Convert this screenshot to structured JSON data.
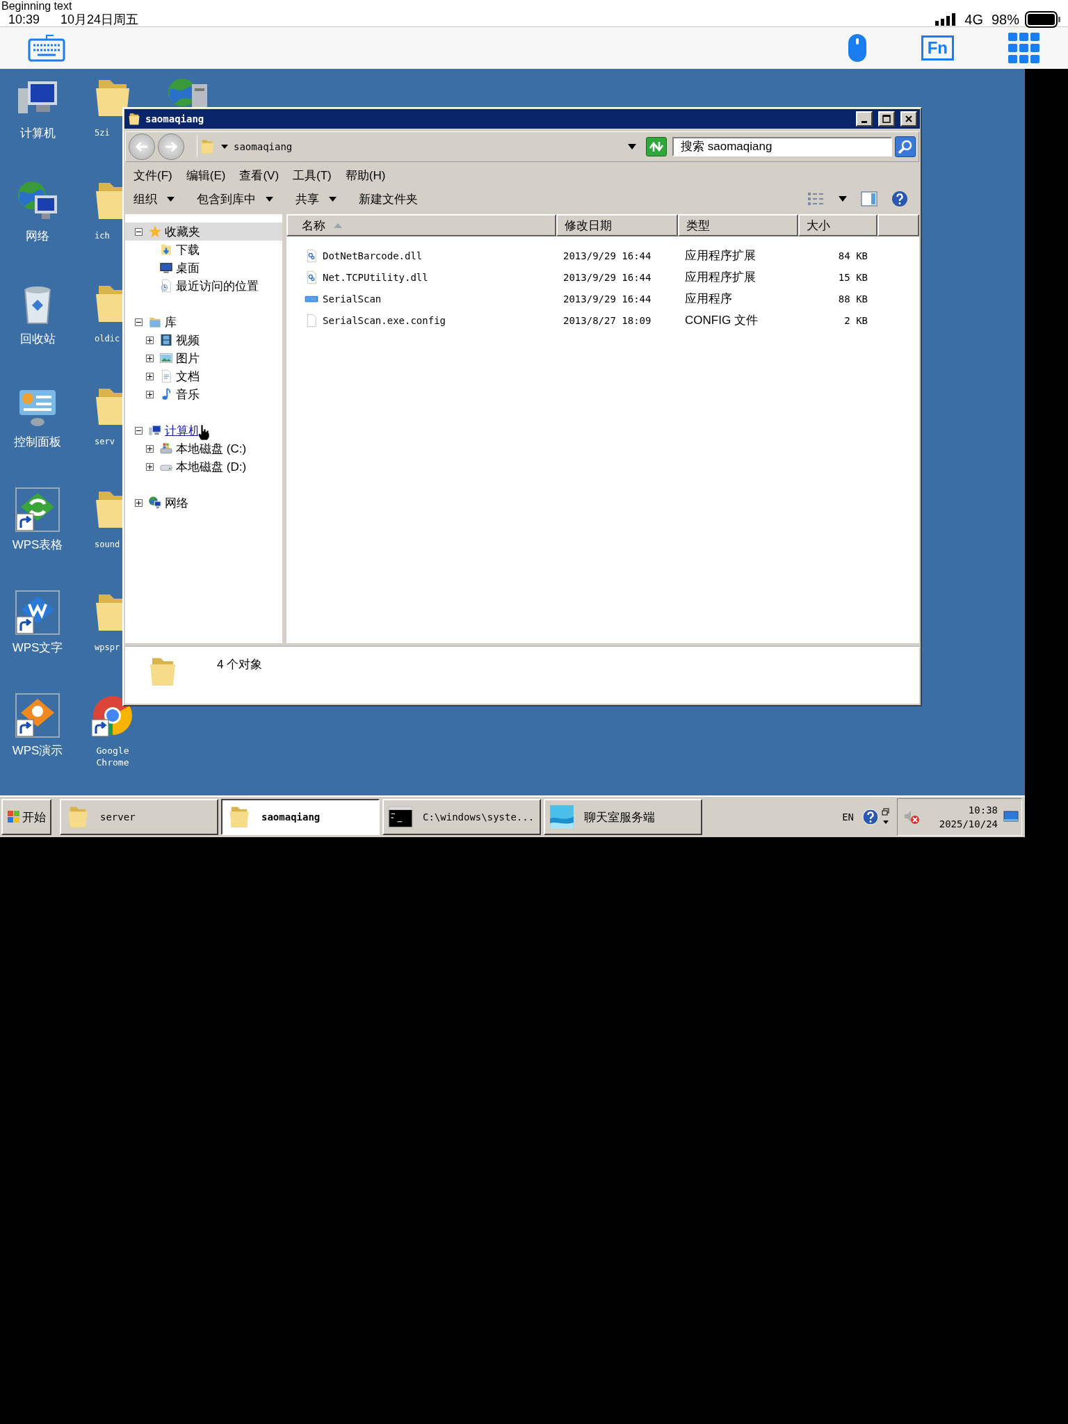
{
  "status_bar": {
    "overlay_text": "Beginning text",
    "time": "10:39",
    "date": "10月24日周五",
    "network": "4G",
    "battery": "98%"
  },
  "remote_toolbar": {
    "fn_key": "Fn"
  },
  "desktop_icons": [
    {
      "label": "计算机",
      "kind": "computer"
    },
    {
      "label": "网络",
      "kind": "network"
    },
    {
      "label": "回收站",
      "kind": "recycle-bin"
    },
    {
      "label": "控制面板",
      "kind": "control-panel"
    },
    {
      "label": "WPS表格",
      "kind": "spreadsheet"
    },
    {
      "label": "WPS文字",
      "kind": "writer"
    },
    {
      "label": "WPS演示",
      "kind": "presentation"
    },
    {
      "label": "5zi",
      "kind": "folder"
    },
    {
      "label": "ich",
      "kind": "folder"
    },
    {
      "label": "oldic",
      "kind": "folder"
    },
    {
      "label": "serv",
      "kind": "folder"
    },
    {
      "label": "sound",
      "kind": "folder"
    },
    {
      "label": "wpspr",
      "kind": "folder"
    },
    {
      "label": "Google Chrome",
      "kind": "browser"
    },
    {
      "kind": "network-server"
    }
  ],
  "window": {
    "title": "saomaqiang",
    "address": "saomaqiang",
    "search": {
      "placeholder": "搜索 saomaqiang"
    },
    "menu": [
      "文件(F)",
      "编辑(E)",
      "查看(V)",
      "工具(T)",
      "帮助(H)"
    ],
    "commands": [
      {
        "label": "组织",
        "dropdown": true
      },
      {
        "label": "包含到库中",
        "dropdown": true
      },
      {
        "label": "共享",
        "dropdown": true
      },
      {
        "label": "新建文件夹",
        "dropdown": false
      }
    ],
    "nav_tree": [
      {
        "label": "收藏夹",
        "kind": "favorites",
        "expanded": true,
        "selected": true,
        "hovered": false,
        "children": [
          {
            "label": "下载",
            "kind": "download",
            "selected": false,
            "hovered": false
          },
          {
            "label": "桌面",
            "kind": "desktop",
            "selected": false,
            "hovered": false
          },
          {
            "label": "最近访问的位置",
            "kind": "recent",
            "selected": false,
            "hovered": false
          }
        ]
      },
      {
        "label": "库",
        "kind": "library",
        "expanded": true,
        "selected": false,
        "hovered": false,
        "children": [
          {
            "label": "视频",
            "kind": "video",
            "expanded": false,
            "selected": false,
            "hovered": false
          },
          {
            "label": "图片",
            "kind": "picture",
            "expanded": false,
            "selected": false,
            "hovered": false
          },
          {
            "label": "文档",
            "kind": "document",
            "expanded": false,
            "selected": false,
            "hovered": false
          },
          {
            "label": "音乐",
            "kind": "music",
            "expanded": false,
            "selected": false,
            "hovered": false
          }
        ]
      },
      {
        "label": "计算机",
        "kind": "computer",
        "expanded": true,
        "selected": false,
        "hovered": true,
        "children": [
          {
            "label": "本地磁盘 (C:)",
            "kind": "drive-system",
            "expanded": false,
            "selected": false,
            "hovered": false
          },
          {
            "label": "本地磁盘 (D:)",
            "kind": "drive",
            "expanded": false,
            "selected": false,
            "hovered": false
          }
        ]
      },
      {
        "label": "网络",
        "kind": "network",
        "expanded": false,
        "selected": false,
        "hovered": false
      }
    ],
    "columns": [
      {
        "label": "名称",
        "sorted": true
      },
      {
        "label": "修改日期",
        "sorted": false
      },
      {
        "label": "类型",
        "sorted": false
      },
      {
        "label": "大小",
        "sorted": false
      }
    ],
    "files": [
      {
        "name": "DotNetBarcode.dll",
        "date": "2013/9/29 16:44",
        "type": "应用程序扩展",
        "size": "84 KB",
        "kind": "dll"
      },
      {
        "name": "Net.TCPUtility.dll",
        "date": "2013/9/29 16:44",
        "type": "应用程序扩展",
        "size": "15 KB",
        "kind": "dll"
      },
      {
        "name": "SerialScan",
        "date": "2013/9/29 16:44",
        "type": "应用程序",
        "size": "88 KB",
        "kind": "exe"
      },
      {
        "name": "SerialScan.exe.config",
        "date": "2013/8/27 18:09",
        "type": "CONFIG 文件",
        "size": "2 KB",
        "kind": "config"
      }
    ],
    "status": "4 个对象"
  },
  "taskbar": {
    "start": "开始",
    "tasks": [
      {
        "label": "server",
        "kind": "folder",
        "selected": false
      },
      {
        "label": "saomaqiang",
        "kind": "folder",
        "selected": true
      },
      {
        "label": "C:\\windows\\syste...",
        "kind": "console",
        "selected": false
      },
      {
        "label": "聊天室服务端",
        "kind": "app",
        "selected": false
      }
    ],
    "language": "EN",
    "clock_time": "10:38",
    "clock_date": "2025/10/24"
  }
}
